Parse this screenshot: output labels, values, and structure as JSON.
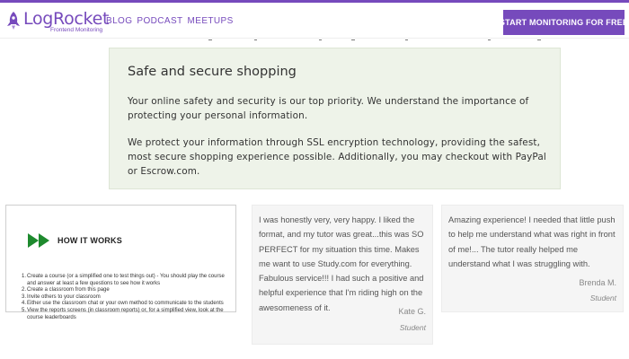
{
  "header": {
    "logo_name": "LogRocket",
    "logo_sub": "Frontend Monitoring",
    "nav": [
      "BLOG",
      "PODCAST",
      "MEETUPS"
    ],
    "cta": "START MONITORING FOR FREE",
    "brand_color": "#764abc"
  },
  "secure": {
    "title": "Safe and secure shopping",
    "p1": "Your online safety and security is our top priority. We understand the importance of protecting your personal information.",
    "p2": "We protect your information through SSL encryption technology, providing the safest, most secure shopping experience possible. Additionally, you may checkout with PayPal or Escrow.com.",
    "bg_color": "#eef3e9"
  },
  "how_it_works": {
    "title": "HOW IT WORKS",
    "icon": "double-play-icon",
    "icon_color": "#1e8a2e",
    "steps": [
      "Create a course (or a simplified one to test things out) - You should play the course and answer at least a few questions to see how it works",
      "Create a classroom from this page",
      "Invite others to your classroom",
      "Either use the classroom chat or your own method to communicate to the students",
      "View the reports screens (in classroom reports) or, for a simplified view, look at the course leaderboards"
    ]
  },
  "testimonials": [
    {
      "quote": "I was honestly very, very happy. I liked the format, and my tutor was great...this was SO PERFECT for my situation this time. Makes me want to use Study.com for everything. Fabulous service!!! I had such a positive and helpful experience that I'm riding high on the awesomeness of it.",
      "name": "Kate G.",
      "role": "Student"
    },
    {
      "quote": "Amazing experience! I needed that little push to help me understand what was right in front of me!... The tutor really helped me understand what I was struggling with.",
      "name": "Brenda M.",
      "role": "Student"
    }
  ]
}
